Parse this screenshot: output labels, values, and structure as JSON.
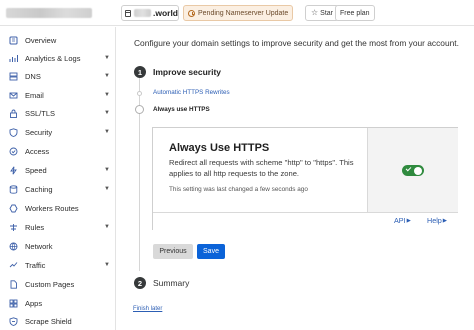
{
  "topbar": {
    "account_name": "",
    "domain_suffix": ".world",
    "pending_badge": "Pending Nameserver Update",
    "star_label": "Star",
    "plan_label": "Free plan"
  },
  "sidebar": {
    "items": [
      {
        "label": "Overview",
        "icon": "overview-icon",
        "chevron": false
      },
      {
        "label": "Analytics & Logs",
        "icon": "analytics-icon",
        "chevron": true
      },
      {
        "label": "DNS",
        "icon": "dns-icon",
        "chevron": true
      },
      {
        "label": "Email",
        "icon": "email-icon",
        "chevron": true
      },
      {
        "label": "SSL/TLS",
        "icon": "lock-icon",
        "chevron": true
      },
      {
        "label": "Security",
        "icon": "shield-icon",
        "chevron": true
      },
      {
        "label": "Access",
        "icon": "access-icon",
        "chevron": false
      },
      {
        "label": "Speed",
        "icon": "speed-icon",
        "chevron": true
      },
      {
        "label": "Caching",
        "icon": "caching-icon",
        "chevron": true
      },
      {
        "label": "Workers Routes",
        "icon": "workers-icon",
        "chevron": false
      },
      {
        "label": "Rules",
        "icon": "rules-icon",
        "chevron": true
      },
      {
        "label": "Network",
        "icon": "network-icon",
        "chevron": false
      },
      {
        "label": "Traffic",
        "icon": "traffic-icon",
        "chevron": true
      },
      {
        "label": "Custom Pages",
        "icon": "custom-pages-icon",
        "chevron": false
      },
      {
        "label": "Apps",
        "icon": "apps-icon",
        "chevron": false
      },
      {
        "label": "Scrape Shield",
        "icon": "scrape-shield-icon",
        "chevron": false
      }
    ]
  },
  "main": {
    "intro": "Configure your domain settings to improve security and get the most from your account.",
    "step1": {
      "number": "1",
      "title": "Improve security"
    },
    "substeps": {
      "done": "Automatic HTTPS Rewrites",
      "current": "Always use HTTPS"
    },
    "card": {
      "title": "Always Use HTTPS",
      "description": "Redirect all requests with scheme \"http\" to \"https\". This applies to all http requests to the zone.",
      "meta": "This setting was last changed a few seconds ago",
      "toggle_on": true,
      "api_label": "API",
      "help_label": "Help"
    },
    "buttons": {
      "previous": "Previous",
      "save": "Save"
    },
    "step2": {
      "number": "2",
      "title": "Summary"
    },
    "finish_later": "Finish later"
  },
  "colors": {
    "accent": "#0b63d8",
    "link": "#2c5eb4",
    "toggle_on": "#2f8a3e",
    "pending_bg": "#fbefe2"
  }
}
